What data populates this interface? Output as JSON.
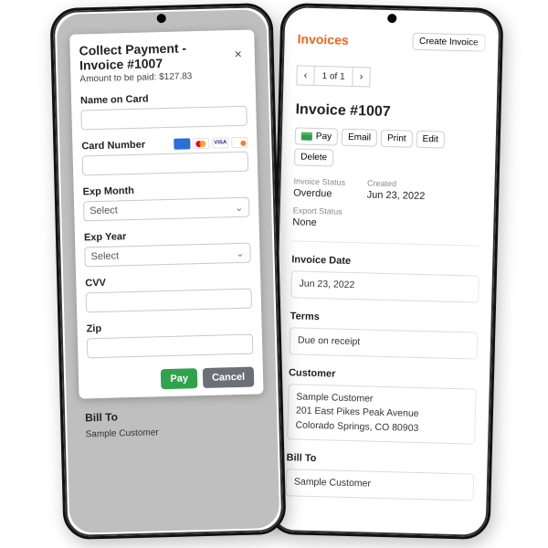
{
  "left": {
    "modal": {
      "title": "Collect Payment - Invoice #1007",
      "subtitle": "Amount to be paid: $127.83",
      "close": "×",
      "name_label": "Name on Card",
      "card_label": "Card Number",
      "exp_month_label": "Exp Month",
      "exp_month_value": "Select",
      "exp_year_label": "Exp Year",
      "exp_year_value": "Select",
      "cvv_label": "CVV",
      "zip_label": "Zip",
      "pay_button": "Pay",
      "cancel_button": "Cancel"
    },
    "behind": {
      "bill_to_heading": "Bill To",
      "bill_to_line1": "Sample Customer"
    }
  },
  "right": {
    "header_title": "Invoices",
    "create_button": "Create Invoice",
    "pager_text": "1 of 1",
    "invoice_title": "Invoice #1007",
    "actions": {
      "pay": "Pay",
      "email": "Email",
      "print": "Print",
      "edit": "Edit",
      "delete": "Delete"
    },
    "meta": {
      "status_label": "Invoice Status",
      "status_value": "Overdue",
      "created_label": "Created",
      "created_value": "Jun 23, 2022",
      "export_label": "Export Status",
      "export_value": "None"
    },
    "invoice_date_label": "Invoice Date",
    "invoice_date_value": "Jun 23, 2022",
    "terms_label": "Terms",
    "terms_value": "Due on receipt",
    "customer_label": "Customer",
    "customer_lines": {
      "l1": "Sample Customer",
      "l2": "201 East Pikes Peak Avenue",
      "l3": "Colorado Springs, CO 80903"
    },
    "bill_to_label": "Bill To",
    "bill_to_lines": {
      "l1": "Sample Customer"
    }
  }
}
